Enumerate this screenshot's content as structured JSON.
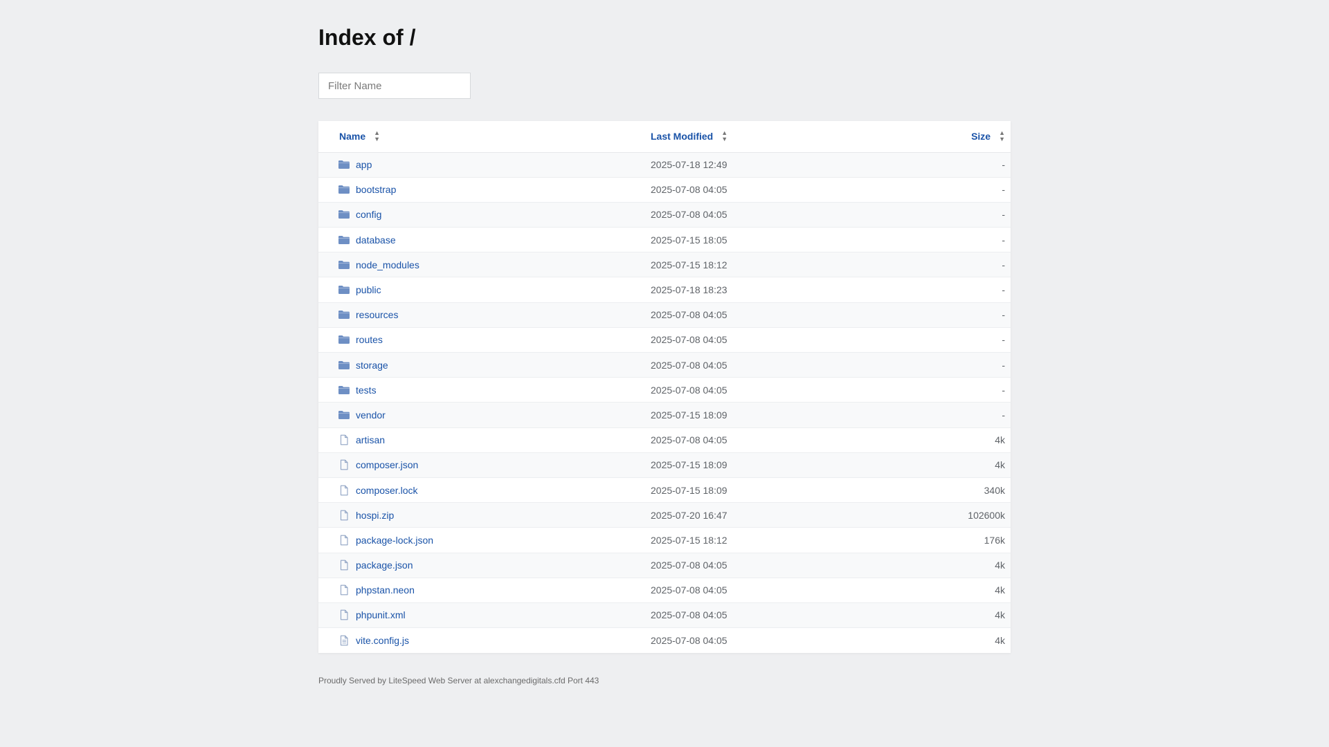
{
  "page": {
    "title": "Index of /",
    "filter_placeholder": "Filter Name",
    "footer": "Proudly Served by LiteSpeed Web Server at alexchangedigitals.cfd Port 443"
  },
  "table": {
    "headers": {
      "name": "Name",
      "last_modified": "Last Modified",
      "size": "Size"
    },
    "rows": [
      {
        "type": "folder",
        "name": "app",
        "modified": "2025-07-18 12:49",
        "size": "-"
      },
      {
        "type": "folder",
        "name": "bootstrap",
        "modified": "2025-07-08 04:05",
        "size": "-"
      },
      {
        "type": "folder",
        "name": "config",
        "modified": "2025-07-08 04:05",
        "size": "-"
      },
      {
        "type": "folder",
        "name": "database",
        "modified": "2025-07-15 18:05",
        "size": "-"
      },
      {
        "type": "folder",
        "name": "node_modules",
        "modified": "2025-07-15 18:12",
        "size": "-"
      },
      {
        "type": "folder",
        "name": "public",
        "modified": "2025-07-18 18:23",
        "size": "-"
      },
      {
        "type": "folder",
        "name": "resources",
        "modified": "2025-07-08 04:05",
        "size": "-"
      },
      {
        "type": "folder",
        "name": "routes",
        "modified": "2025-07-08 04:05",
        "size": "-"
      },
      {
        "type": "folder",
        "name": "storage",
        "modified": "2025-07-08 04:05",
        "size": "-"
      },
      {
        "type": "folder",
        "name": "tests",
        "modified": "2025-07-08 04:05",
        "size": "-"
      },
      {
        "type": "folder",
        "name": "vendor",
        "modified": "2025-07-15 18:09",
        "size": "-"
      },
      {
        "type": "file",
        "name": "artisan",
        "modified": "2025-07-08 04:05",
        "size": "4k"
      },
      {
        "type": "file",
        "name": "composer.json",
        "modified": "2025-07-15 18:09",
        "size": "4k"
      },
      {
        "type": "file",
        "name": "composer.lock",
        "modified": "2025-07-15 18:09",
        "size": "340k"
      },
      {
        "type": "file",
        "name": "hospi.zip",
        "modified": "2025-07-20 16:47",
        "size": "102600k"
      },
      {
        "type": "file",
        "name": "package-lock.json",
        "modified": "2025-07-15 18:12",
        "size": "176k"
      },
      {
        "type": "file",
        "name": "package.json",
        "modified": "2025-07-08 04:05",
        "size": "4k"
      },
      {
        "type": "file",
        "name": "phpstan.neon",
        "modified": "2025-07-08 04:05",
        "size": "4k"
      },
      {
        "type": "file",
        "name": "phpunit.xml",
        "modified": "2025-07-08 04:05",
        "size": "4k"
      },
      {
        "type": "text-file",
        "name": "vite.config.js",
        "modified": "2025-07-08 04:05",
        "size": "4k"
      }
    ]
  },
  "colors": {
    "link": "#1a53a8",
    "folder_icon": "#6e8fc4",
    "file_icon": "#8fa3c4",
    "background": "#eeeff1"
  },
  "icons": {
    "folder": "folder-icon",
    "file": "file-icon",
    "text-file": "file-text-icon",
    "sort": "sort-icon"
  }
}
